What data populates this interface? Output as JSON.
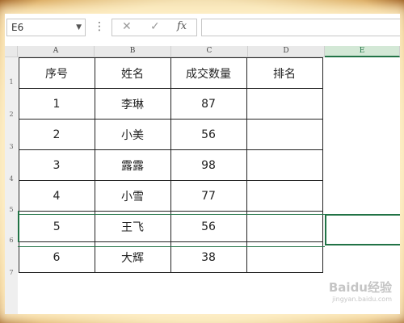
{
  "formula_bar": {
    "name_box": "E6",
    "cancel_icon": "✕",
    "confirm_icon": "✓",
    "function_icon": "fx",
    "formula_value": ""
  },
  "columns": [
    "A",
    "B",
    "C",
    "D",
    "E"
  ],
  "active_column": "E",
  "row_numbers": [
    "1",
    "2",
    "3",
    "4",
    "5",
    "6",
    "7"
  ],
  "table": {
    "headers": [
      "序号",
      "姓名",
      "成交数量",
      "排名"
    ],
    "rows": [
      [
        "1",
        "李琳",
        "87",
        ""
      ],
      [
        "2",
        "小美",
        "56",
        ""
      ],
      [
        "3",
        "露露",
        "98",
        ""
      ],
      [
        "4",
        "小雪",
        "77",
        ""
      ],
      [
        "5",
        "王飞",
        "56",
        ""
      ],
      [
        "6",
        "大辉",
        "38",
        ""
      ]
    ]
  },
  "watermark": {
    "brand": "Baidu经验",
    "url": "jingyan.baidu.com"
  },
  "colors": {
    "accent": "#217346",
    "frame": "#9b5a1c"
  }
}
